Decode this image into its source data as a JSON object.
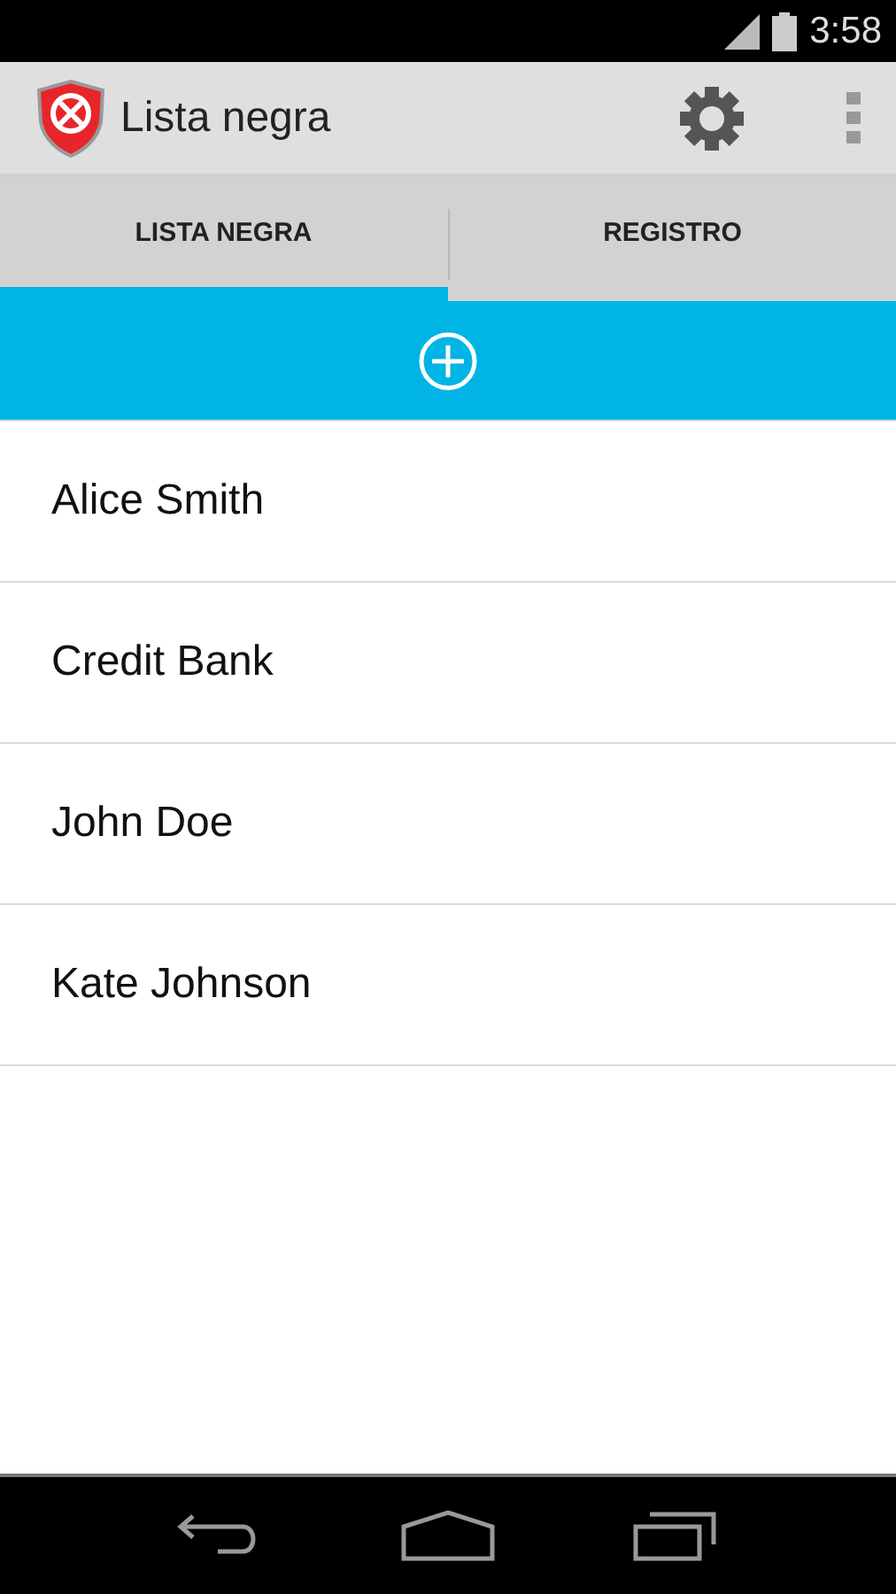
{
  "status_bar": {
    "time": "3:58"
  },
  "app_bar": {
    "title": "Lista negra"
  },
  "tabs": [
    {
      "label": "LISTA NEGRA",
      "selected": true
    },
    {
      "label": "REGISTRO",
      "selected": false
    }
  ],
  "contacts": [
    {
      "name": "Alice Smith"
    },
    {
      "name": "Credit Bank"
    },
    {
      "name": "John Doe"
    },
    {
      "name": "Kate Johnson"
    }
  ]
}
